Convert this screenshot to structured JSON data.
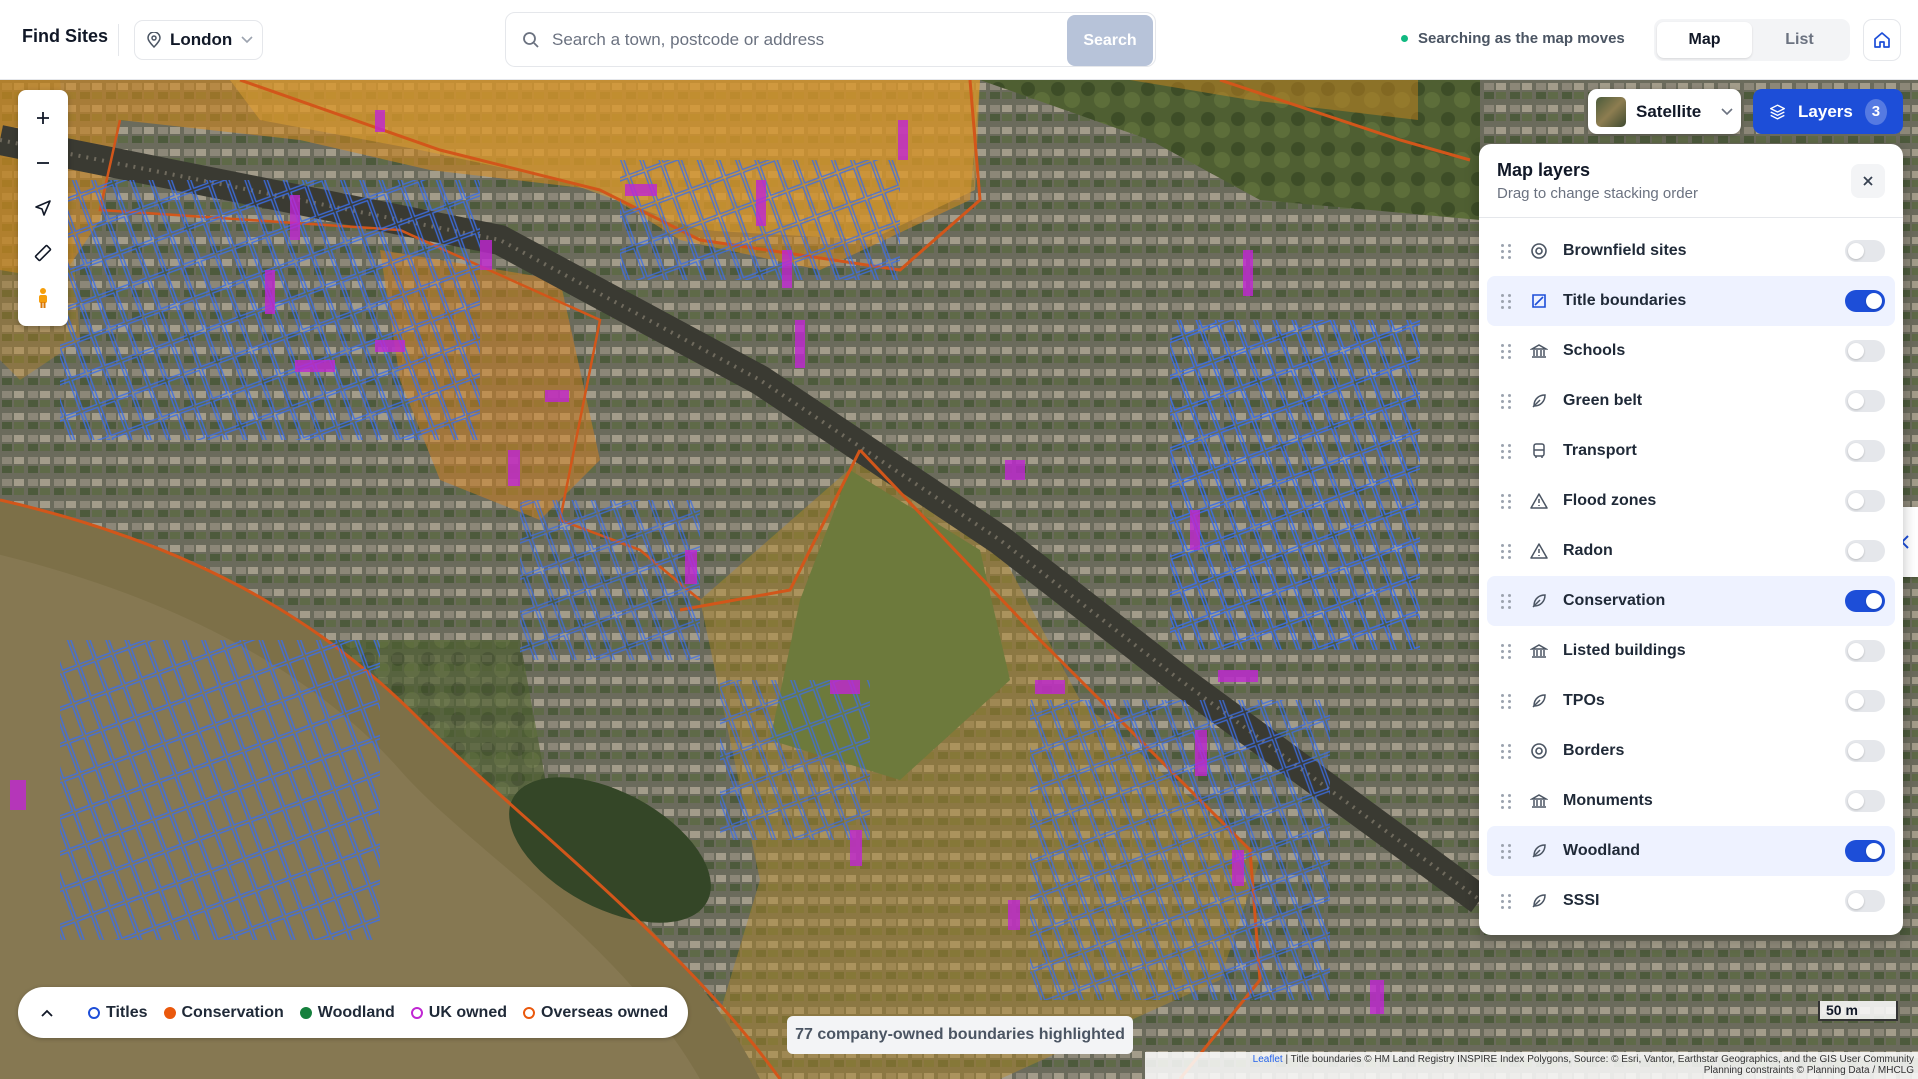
{
  "header": {
    "brand": "Find Sites",
    "location": "London",
    "search_placeholder": "Search a town, postcode or address",
    "search_button": "Search",
    "live_status": "Searching as the map moves",
    "view_tabs": [
      {
        "label": "Map",
        "active": true
      },
      {
        "label": "List",
        "active": false
      }
    ]
  },
  "map_controls": {
    "basemap_label": "Satellite",
    "layers_label": "Layers",
    "layers_count": "3",
    "tools": [
      "plus-icon",
      "minus-icon",
      "locate-icon",
      "ruler-icon",
      "pegman-icon"
    ]
  },
  "panel": {
    "title": "Map layers",
    "subtitle": "Drag to change stacking order",
    "layers": [
      {
        "name": "Brownfield sites",
        "icon": "target-icon",
        "on": false
      },
      {
        "name": "Title boundaries",
        "icon": "boundary-icon",
        "on": true
      },
      {
        "name": "Schools",
        "icon": "building-icon",
        "on": false
      },
      {
        "name": "Green belt",
        "icon": "leaf-icon",
        "on": false
      },
      {
        "name": "Transport",
        "icon": "bus-icon",
        "on": false
      },
      {
        "name": "Flood zones",
        "icon": "warning-icon",
        "on": false
      },
      {
        "name": "Radon",
        "icon": "warning-icon",
        "on": false
      },
      {
        "name": "Conservation",
        "icon": "leaf-icon",
        "on": true
      },
      {
        "name": "Listed buildings",
        "icon": "building-icon",
        "on": false
      },
      {
        "name": "TPOs",
        "icon": "leaf-icon",
        "on": false
      },
      {
        "name": "Borders",
        "icon": "target-icon",
        "on": false
      },
      {
        "name": "Monuments",
        "icon": "building-icon",
        "on": false
      },
      {
        "name": "Woodland",
        "icon": "leaf-icon",
        "on": true
      },
      {
        "name": "SSSI",
        "icon": "leaf-icon",
        "on": false
      }
    ]
  },
  "legend": {
    "items": [
      {
        "label": "Titles",
        "color": "#1d4ed8",
        "style": "ring"
      },
      {
        "label": "Conservation",
        "color": "#ea580c",
        "style": "dot"
      },
      {
        "label": "Woodland",
        "color": "#15803d",
        "style": "dot"
      },
      {
        "label": "UK owned",
        "color": "#c026d3",
        "style": "ring"
      },
      {
        "label": "Overseas owned",
        "color": "#ea580c",
        "style": "ring"
      }
    ]
  },
  "status_chip": "77 company-owned boundaries highlighted",
  "scale_label": "50 m",
  "attribution": {
    "leaflet": "Leaflet",
    "line1": "| Title boundaries © HM Land Registry INSPIRE Index Polygons, Source: © Esri, Vantor, Earthstar Geographics, and the GIS User Community",
    "line2": "Planning constraints © Planning Data / MHCLG"
  },
  "colors": {
    "accent": "#1d4ed8",
    "conservation": "#ea580c",
    "title_boundary": "#2f5bd3",
    "company_owned": "#c026d3"
  }
}
